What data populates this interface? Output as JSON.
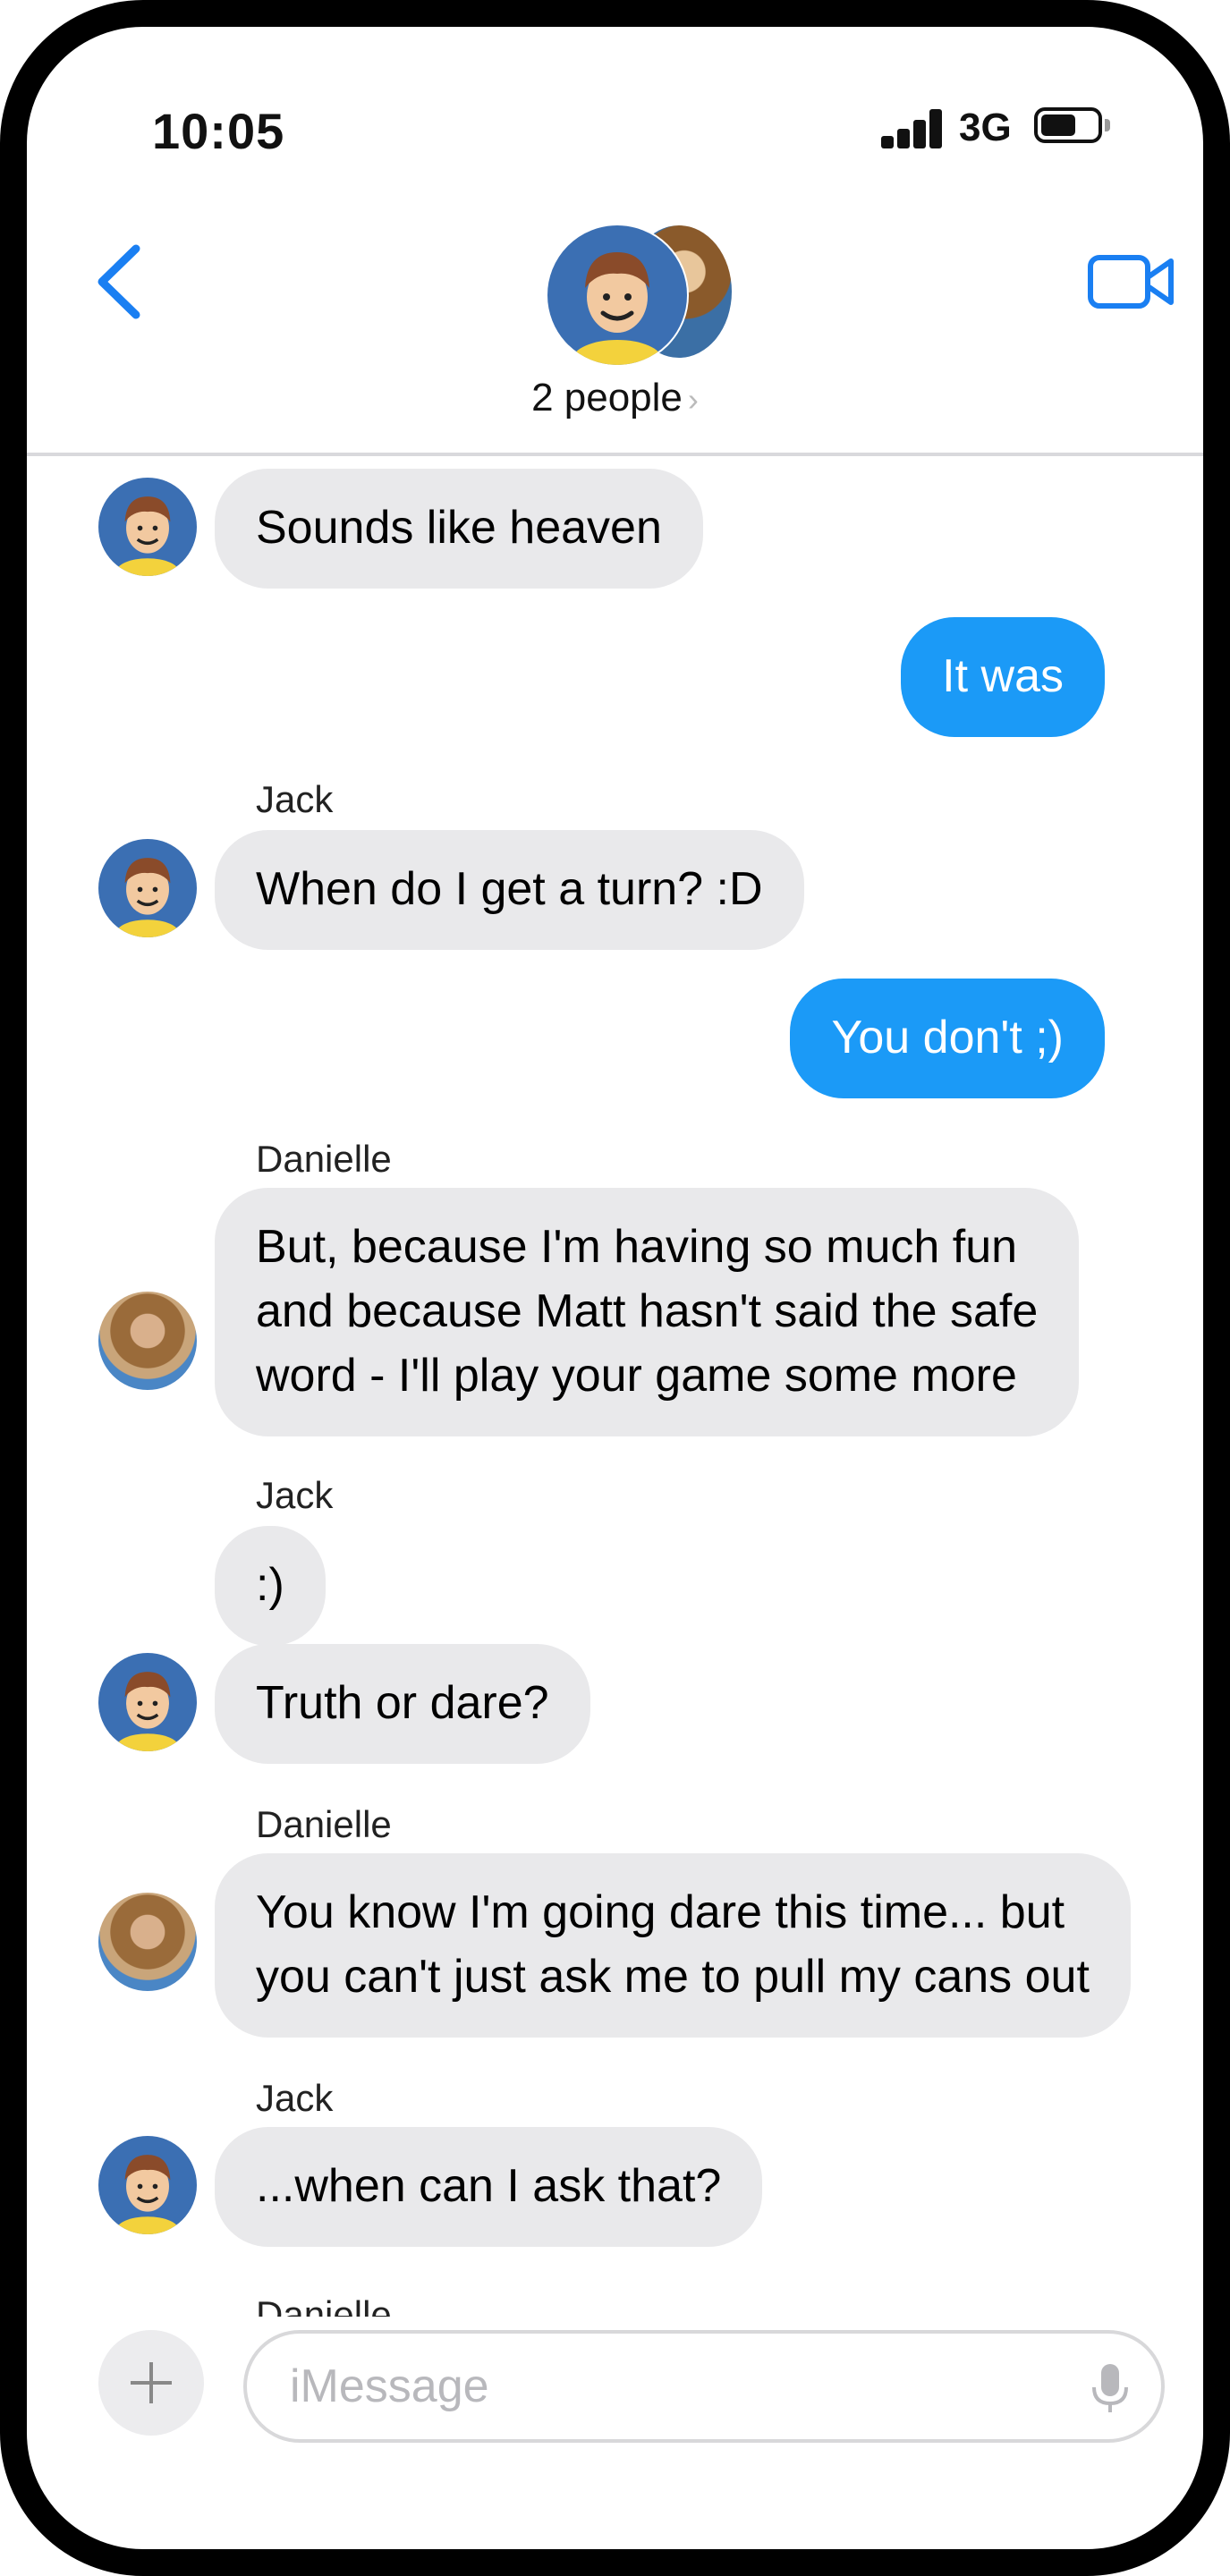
{
  "status_bar": {
    "time": "10:05",
    "network": "3G"
  },
  "header": {
    "group_label": "2 people",
    "chevron": "›"
  },
  "icons": {
    "back": "chevron-left-icon",
    "video": "video-camera-icon",
    "mic": "microphone-icon",
    "plus": "plus-icon"
  },
  "colors": {
    "accent": "#1b9af7",
    "incoming_bubble": "#e9e9eb",
    "ios_blue": "#1a7ff2"
  },
  "messages": [
    {
      "sender": "",
      "direction": "in",
      "avatar": "jack",
      "text": "Sounds like heaven"
    },
    {
      "sender": "",
      "direction": "out",
      "text": "It was"
    },
    {
      "sender": "Jack",
      "direction": "in",
      "avatar": "jack",
      "text": "When do I get a turn? :D"
    },
    {
      "sender": "",
      "direction": "out",
      "text": "You don't ;)"
    },
    {
      "sender": "Danielle",
      "direction": "in",
      "avatar": "danielle",
      "text": "But, because I'm having so much fun\nand because Matt hasn't said the safe\nword - I'll play your game some more"
    },
    {
      "sender": "Jack",
      "direction": "in",
      "avatar": "",
      "text": ":)"
    },
    {
      "sender": "",
      "direction": "in",
      "avatar": "jack",
      "text": "Truth or dare?"
    },
    {
      "sender": "Danielle",
      "direction": "in",
      "avatar": "danielle",
      "text": "You know I'm going dare this time... but\nyou can't just ask me to pull my cans out"
    },
    {
      "sender": "Jack",
      "direction": "in",
      "avatar": "jack",
      "text": "...when can I ask that?"
    }
  ],
  "partial_sender": "Danielle",
  "composer": {
    "placeholder": "iMessage",
    "value": ""
  }
}
